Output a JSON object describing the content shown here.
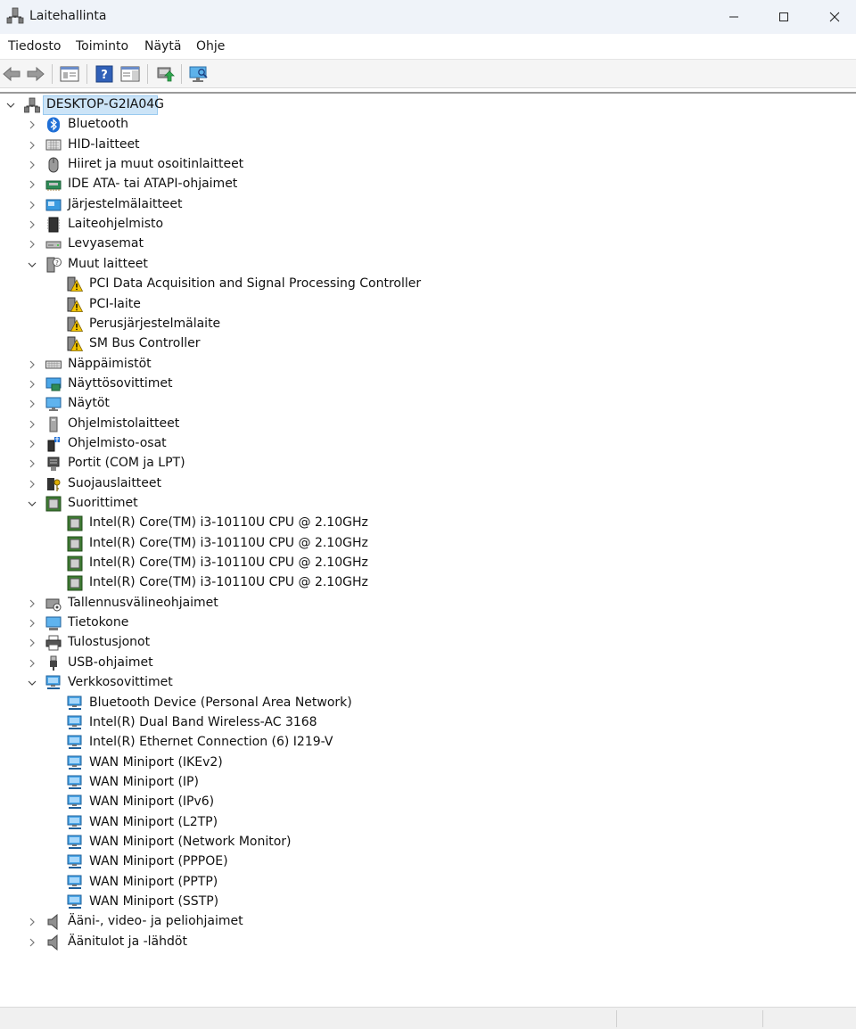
{
  "window": {
    "title": "Laitehallinta"
  },
  "menu": [
    "Tiedosto",
    "Toiminto",
    "Näytä",
    "Ohje"
  ],
  "toolbar": {
    "buttons": [
      "back-icon",
      "forward-icon",
      "properties-sheet-icon",
      "help-icon",
      "action-pane-icon",
      "update-driver-icon",
      "scan-hardware-icon"
    ]
  },
  "tree": {
    "root": "DESKTOP-G2IA04G",
    "categories": [
      {
        "label": "Bluetooth",
        "icon": "bluetooth-icon",
        "expanded": false
      },
      {
        "label": "HID-laitteet",
        "icon": "hid-icon",
        "expanded": false
      },
      {
        "label": "Hiiret ja muut osoitinlaitteet",
        "icon": "mouse-icon",
        "expanded": false
      },
      {
        "label": "IDE ATA- tai ATAPI-ohjaimet",
        "icon": "ide-icon",
        "expanded": false
      },
      {
        "label": "Järjestelmälaitteet",
        "icon": "system-folder-icon",
        "expanded": false
      },
      {
        "label": "Laiteohjelmisto",
        "icon": "firmware-icon",
        "expanded": false
      },
      {
        "label": "Levyasemat",
        "icon": "disk-drive-icon",
        "expanded": false
      },
      {
        "label": "Muut laitteet",
        "icon": "unknown-device-icon",
        "expanded": true,
        "children": [
          "PCI Data Acquisition and Signal Processing Controller",
          "PCI-laite",
          "Perusjärjestelmälaite",
          "SM Bus Controller"
        ],
        "child_icon": "warning-device-icon"
      },
      {
        "label": "Näppäimistöt",
        "icon": "keyboard-icon",
        "expanded": false
      },
      {
        "label": "Näyttösovittimet",
        "icon": "display-adapter-icon",
        "expanded": false
      },
      {
        "label": "Näytöt",
        "icon": "monitor-icon",
        "expanded": false
      },
      {
        "label": "Ohjelmistolaitteet",
        "icon": "software-device-icon",
        "expanded": false
      },
      {
        "label": "Ohjelmisto-osat",
        "icon": "software-component-icon",
        "expanded": false
      },
      {
        "label": "Portit (COM ja LPT)",
        "icon": "port-icon",
        "expanded": false
      },
      {
        "label": "Suojauslaitteet",
        "icon": "security-device-icon",
        "expanded": false
      },
      {
        "label": "Suorittimet",
        "icon": "processor-icon",
        "expanded": true,
        "children": [
          "Intel(R) Core(TM) i3-10110U CPU @ 2.10GHz",
          "Intel(R) Core(TM) i3-10110U CPU @ 2.10GHz",
          "Intel(R) Core(TM) i3-10110U CPU @ 2.10GHz",
          "Intel(R) Core(TM) i3-10110U CPU @ 2.10GHz"
        ],
        "child_icon": "processor-icon"
      },
      {
        "label": "Tallennusvälineohjaimet",
        "icon": "storage-controller-icon",
        "expanded": false
      },
      {
        "label": "Tietokone",
        "icon": "computer-icon",
        "expanded": false
      },
      {
        "label": "Tulostusjonot",
        "icon": "printer-icon",
        "expanded": false
      },
      {
        "label": "USB-ohjaimet",
        "icon": "usb-icon",
        "expanded": false
      },
      {
        "label": "Verkkosovittimet",
        "icon": "network-adapter-icon",
        "expanded": true,
        "children": [
          "Bluetooth Device (Personal Area Network)",
          "Intel(R) Dual Band Wireless-AC 3168",
          "Intel(R) Ethernet Connection (6) I219-V",
          "WAN Miniport (IKEv2)",
          "WAN Miniport (IP)",
          "WAN Miniport (IPv6)",
          "WAN Miniport (L2TP)",
          "WAN Miniport (Network Monitor)",
          "WAN Miniport (PPPOE)",
          "WAN Miniport (PPTP)",
          "WAN Miniport (SSTP)"
        ],
        "child_icon": "network-adapter-icon"
      },
      {
        "label": "Ääni-, video- ja peliohjaimet",
        "icon": "speaker-icon",
        "expanded": false
      },
      {
        "label": "Äänitulot ja -lähdöt",
        "icon": "speaker-icon",
        "expanded": false
      }
    ]
  },
  "colors": {
    "titlebar": "#eff3f9",
    "selection": "#cce4f7",
    "network_blue": "#2b8fd8",
    "warning": "#f2c400",
    "processor_green": "#3e7d32"
  }
}
